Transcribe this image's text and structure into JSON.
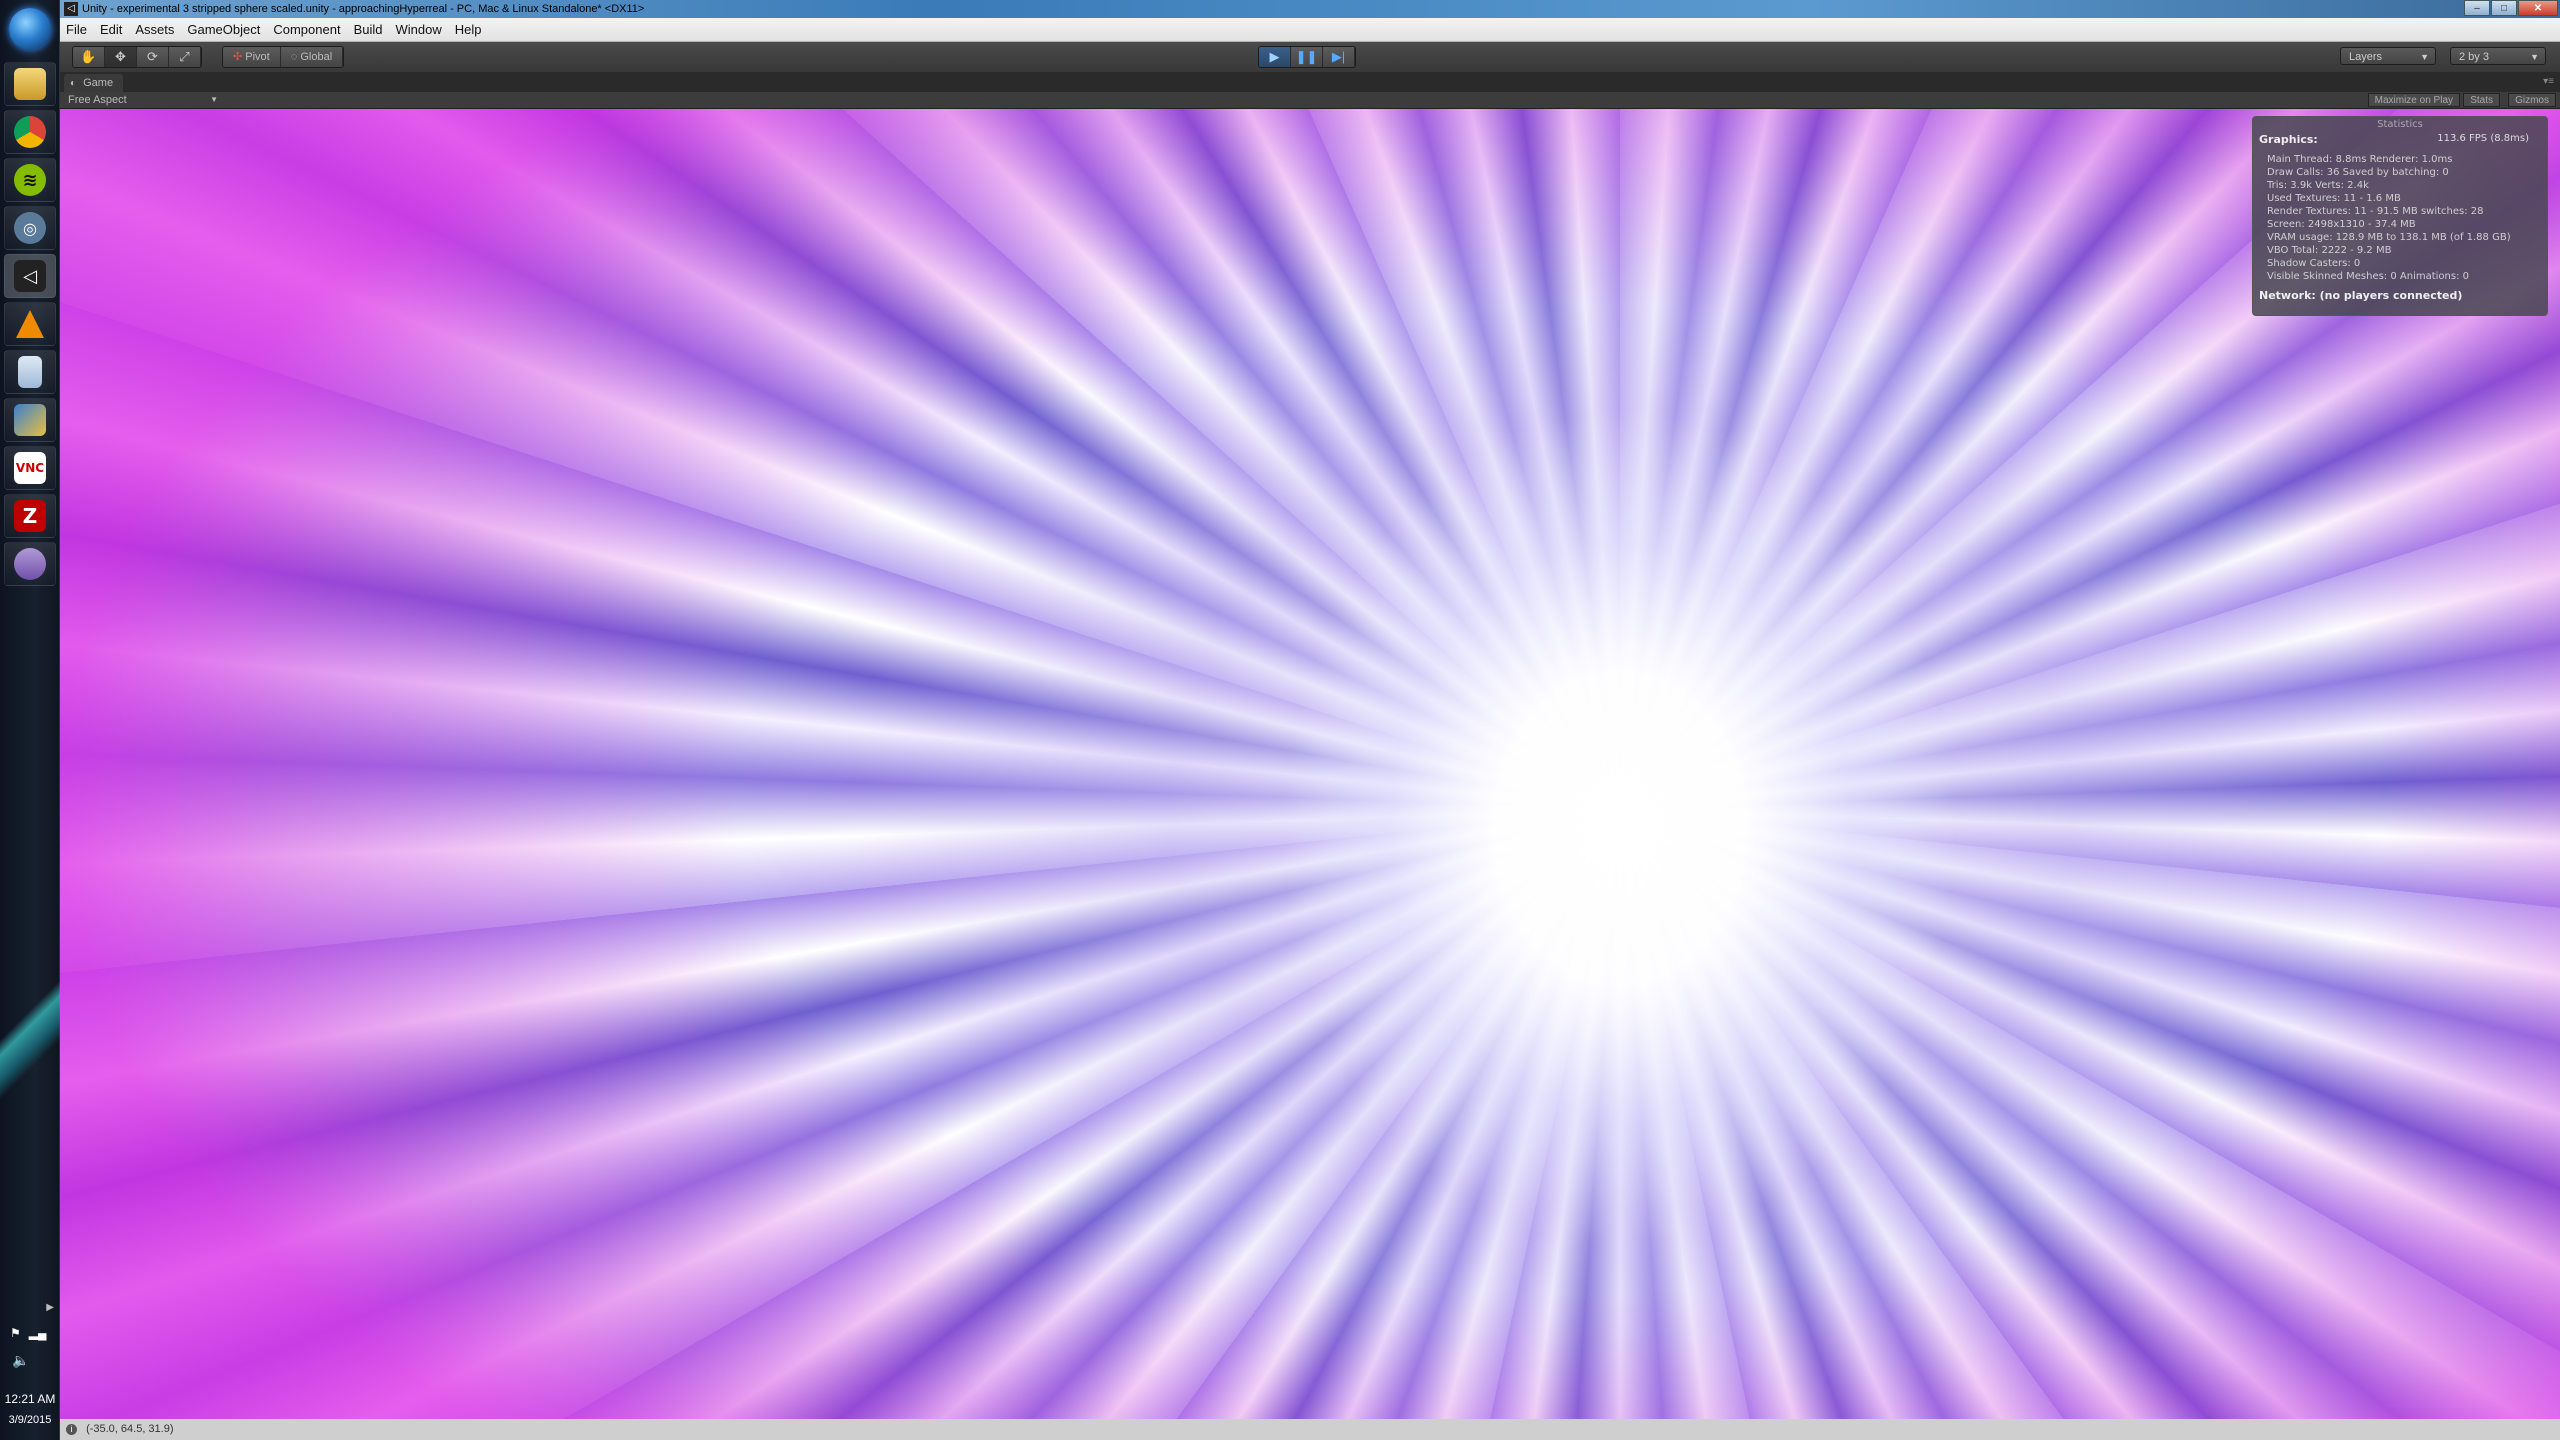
{
  "window": {
    "title": "Unity - experimental 3 stripped sphere scaled.unity - approachingHyperreal - PC, Mac & Linux Standalone* <DX11>",
    "minimize": "–",
    "maximize": "□",
    "close": "✕"
  },
  "menu": [
    "File",
    "Edit",
    "Assets",
    "GameObject",
    "Component",
    "Build",
    "Window",
    "Help"
  ],
  "toolbar": {
    "pivot_label": "Pivot",
    "global_label": "Global",
    "layers_label": "Layers",
    "layout_label": "2 by 3"
  },
  "game_view": {
    "tab_label": "Game",
    "aspect_label": "Free Aspect",
    "maximize_on_play": "Maximize on Play",
    "stats_label": "Stats",
    "gizmos_label": "Gizmos"
  },
  "stats": {
    "header": "Statistics",
    "graphics_label": "Graphics:",
    "fps": "113.6 FPS (8.8ms)",
    "lines": [
      "Main Thread: 8.8ms   Renderer: 1.0ms",
      "Draw Calls: 36     Saved by batching: 0",
      "Tris: 3.9k     Verts: 2.4k",
      "Used Textures: 11 - 1.6 MB",
      "Render Textures: 11 - 91.5 MB   switches: 28",
      "Screen: 2498x1310 - 37.4 MB",
      "VRAM usage: 128.9 MB to 138.1 MB (of 1.88 GB)",
      "VBO Total: 2222 - 9.2 MB",
      "Shadow Casters: 0",
      "Visible Skinned Meshes: 0      Animations: 0"
    ],
    "network": "Network: (no players connected)"
  },
  "status_bar": {
    "text": "(-35.0, 64.5, 31.9)"
  },
  "taskbar": {
    "time": "12:21 AM",
    "date": "3/9/2015",
    "icons": [
      "file-explorer-icon",
      "chrome-icon",
      "spotify-icon",
      "steam-icon",
      "unity-icon",
      "vlc-icon",
      "notepad-icon",
      "network-tool-icon",
      "vnc-icon",
      "filezilla-icon",
      "pidgin-icon"
    ]
  },
  "colors": {
    "unity_dark": "#383838",
    "play_blue": "#58a8ff",
    "viewport_purple": "#9b6ae0",
    "viewport_magenta": "#d040e0"
  }
}
